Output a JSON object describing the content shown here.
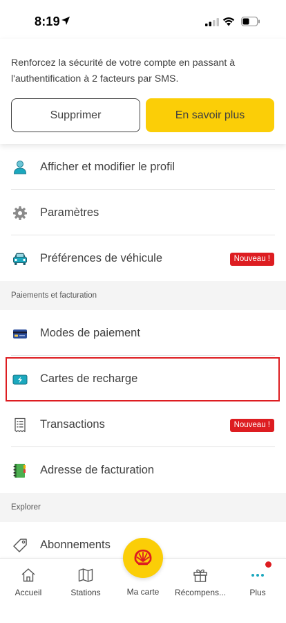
{
  "status_bar": {
    "time": "8:19"
  },
  "banner": {
    "text": "Renforcez la sécurité de votre compte en passant à l'authentification à 2 facteurs par SMS.",
    "secondary_button": "Supprimer",
    "primary_button": "En savoir plus"
  },
  "menu": {
    "profile": "Afficher et modifier le profil",
    "settings": "Paramètres",
    "vehicle": "Préférences de véhicule",
    "vehicle_badge": "Nouveau !",
    "payments_header": "Paiements et facturation",
    "payment_methods": "Modes de paiement",
    "charging_cards": "Cartes de recharge",
    "transactions": "Transactions",
    "transactions_badge": "Nouveau !",
    "billing_address": "Adresse de facturation",
    "explore_header": "Explorer",
    "subscriptions": "Abonnements"
  },
  "bottom_nav": {
    "home": "Accueil",
    "stations": "Stations",
    "map": "Ma carte",
    "rewards": "Récompens...",
    "more": "Plus"
  },
  "colors": {
    "accent_yellow": "#FBCE07",
    "badge_red": "#DD1D21",
    "text": "#404040",
    "teal": "#1BA8BE"
  },
  "icons": {
    "profile": "user-icon",
    "settings": "gear-icon",
    "vehicle": "car-icon",
    "payment": "credit-card-icon",
    "charging": "charging-card-icon",
    "transactions": "receipt-icon",
    "billing": "address-book-icon",
    "subscriptions": "tag-icon"
  }
}
